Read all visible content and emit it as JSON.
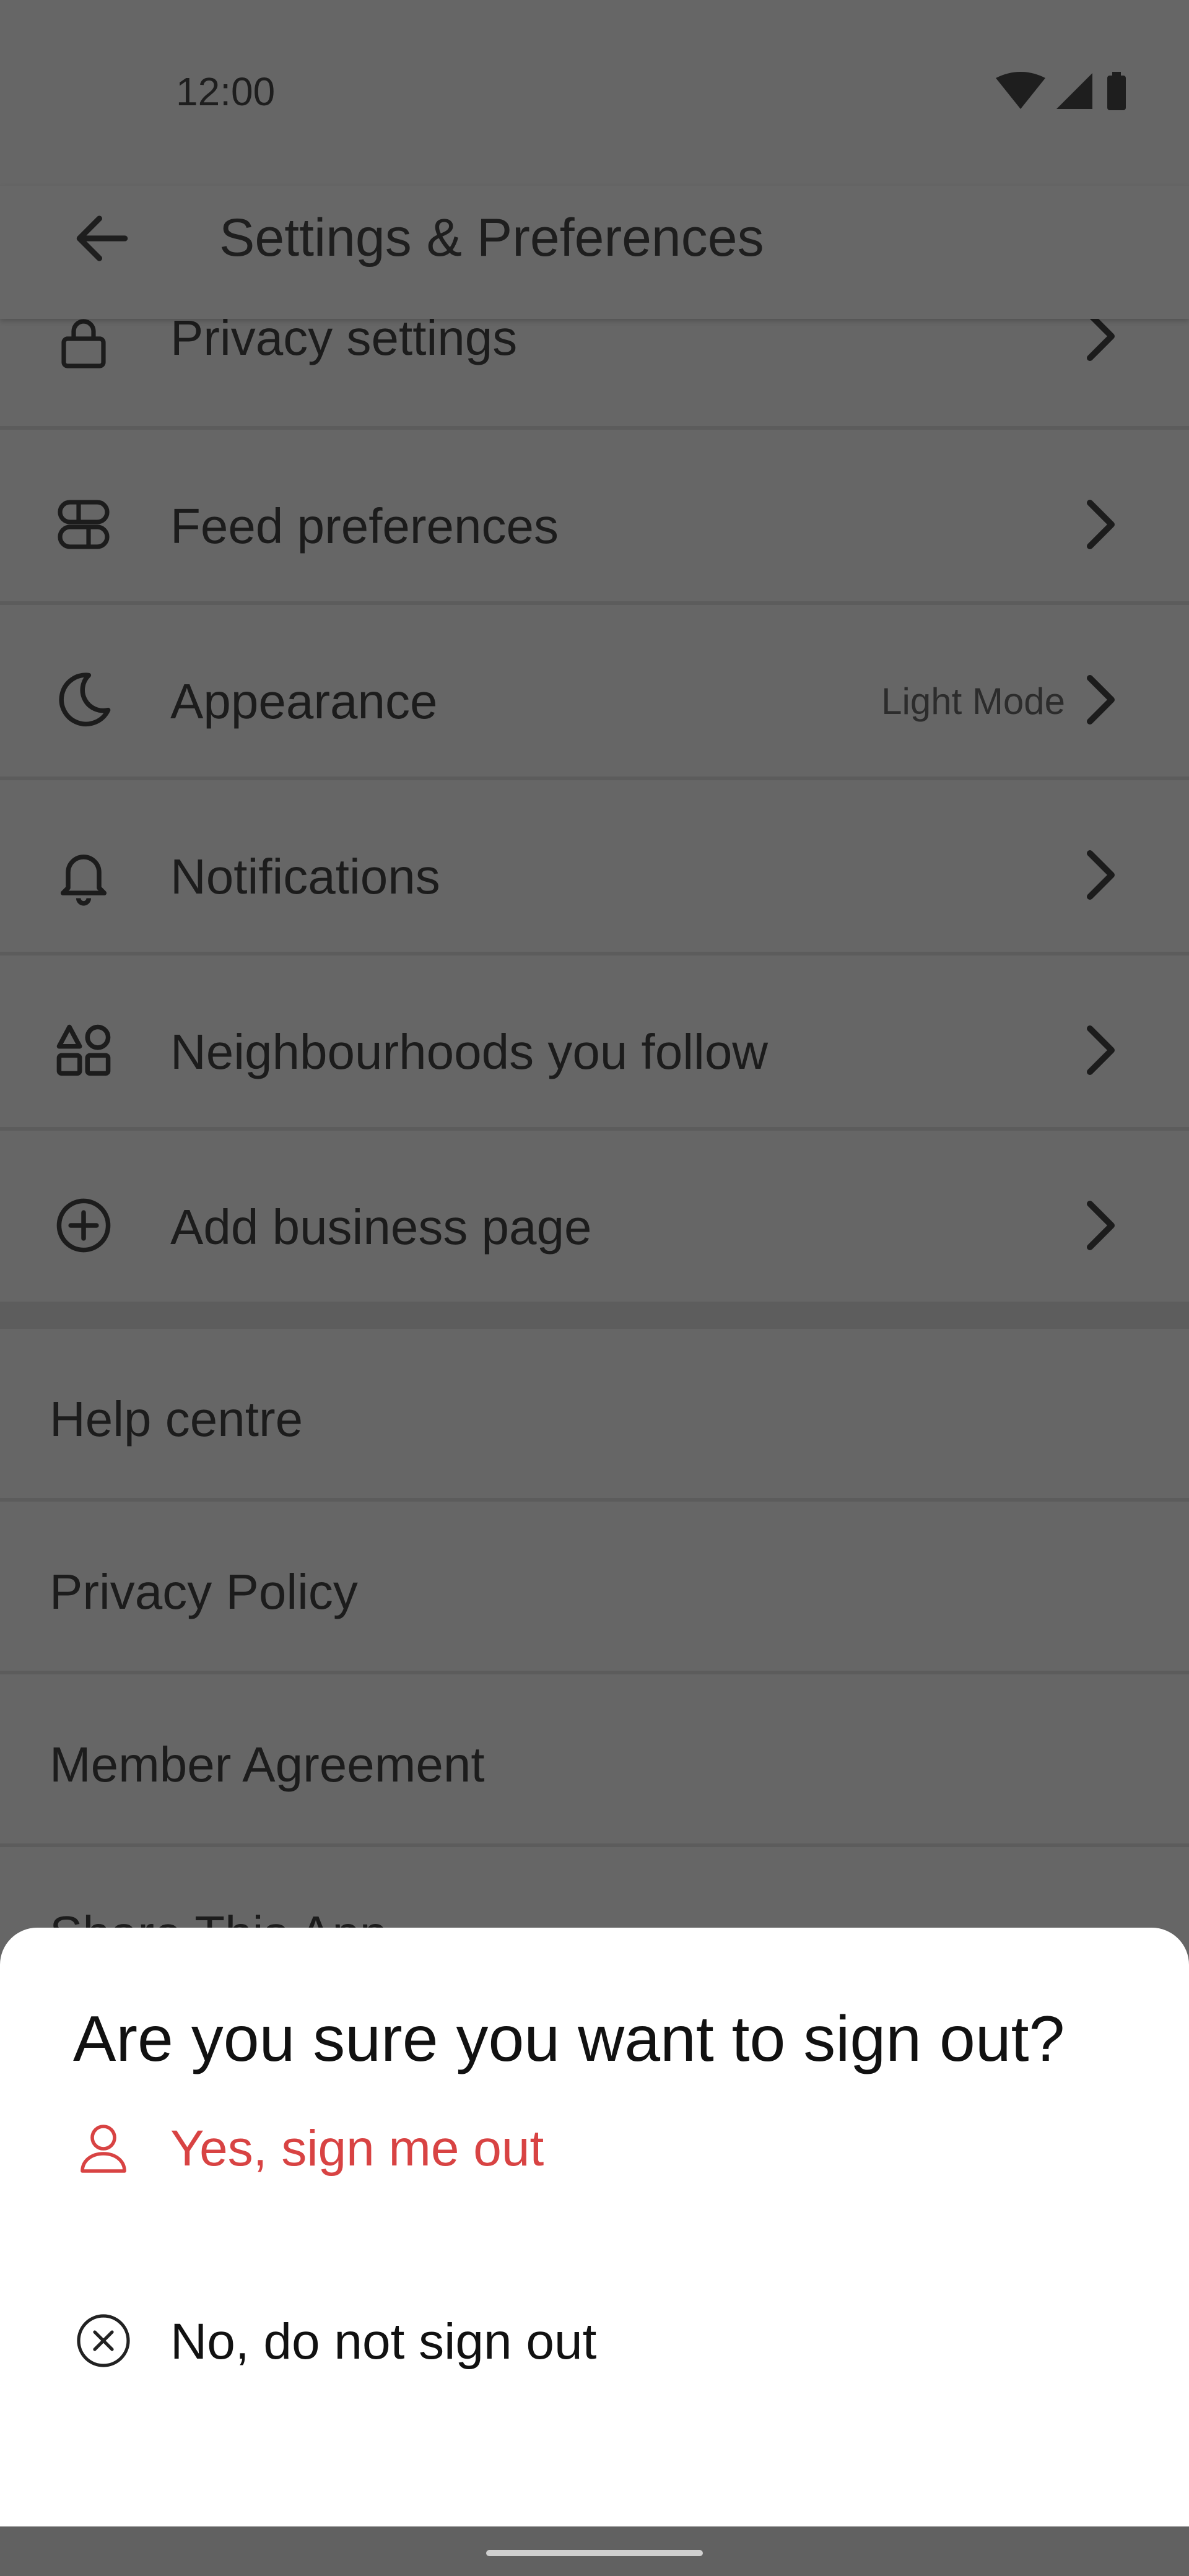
{
  "status_bar": {
    "time": "12:00",
    "icons": [
      "wifi-icon",
      "cell-signal-icon",
      "battery-icon"
    ]
  },
  "app_bar": {
    "title": "Settings & Preferences",
    "back_icon": "arrow-back-icon"
  },
  "settings": [
    {
      "label": "Privacy settings",
      "icon": "lock-icon",
      "value": ""
    },
    {
      "label": "Feed preferences",
      "icon": "feed-icon",
      "value": ""
    },
    {
      "label": "Appearance",
      "icon": "moon-icon",
      "value": "Light Mode"
    },
    {
      "label": "Notifications",
      "icon": "bell-icon",
      "value": ""
    },
    {
      "label": "Neighbourhoods you follow",
      "icon": "grid-icon",
      "value": ""
    },
    {
      "label": "Add business page",
      "icon": "add-circle-icon",
      "value": ""
    }
  ],
  "links": [
    {
      "label": "Help centre"
    },
    {
      "label": "Privacy Policy"
    },
    {
      "label": "Member Agreement"
    },
    {
      "label": "Share This App"
    }
  ],
  "sign_out_sheet": {
    "title": "Are you sure you want to sign out?",
    "confirm_label": "Yes, sign me out",
    "confirm_icon": "person-icon",
    "cancel_label": "No, do not sign out",
    "cancel_icon": "close-circle-icon"
  },
  "colors": {
    "scrim_background": "#666666",
    "confirm_text": "#d84343",
    "sheet_background": "#ffffff"
  }
}
